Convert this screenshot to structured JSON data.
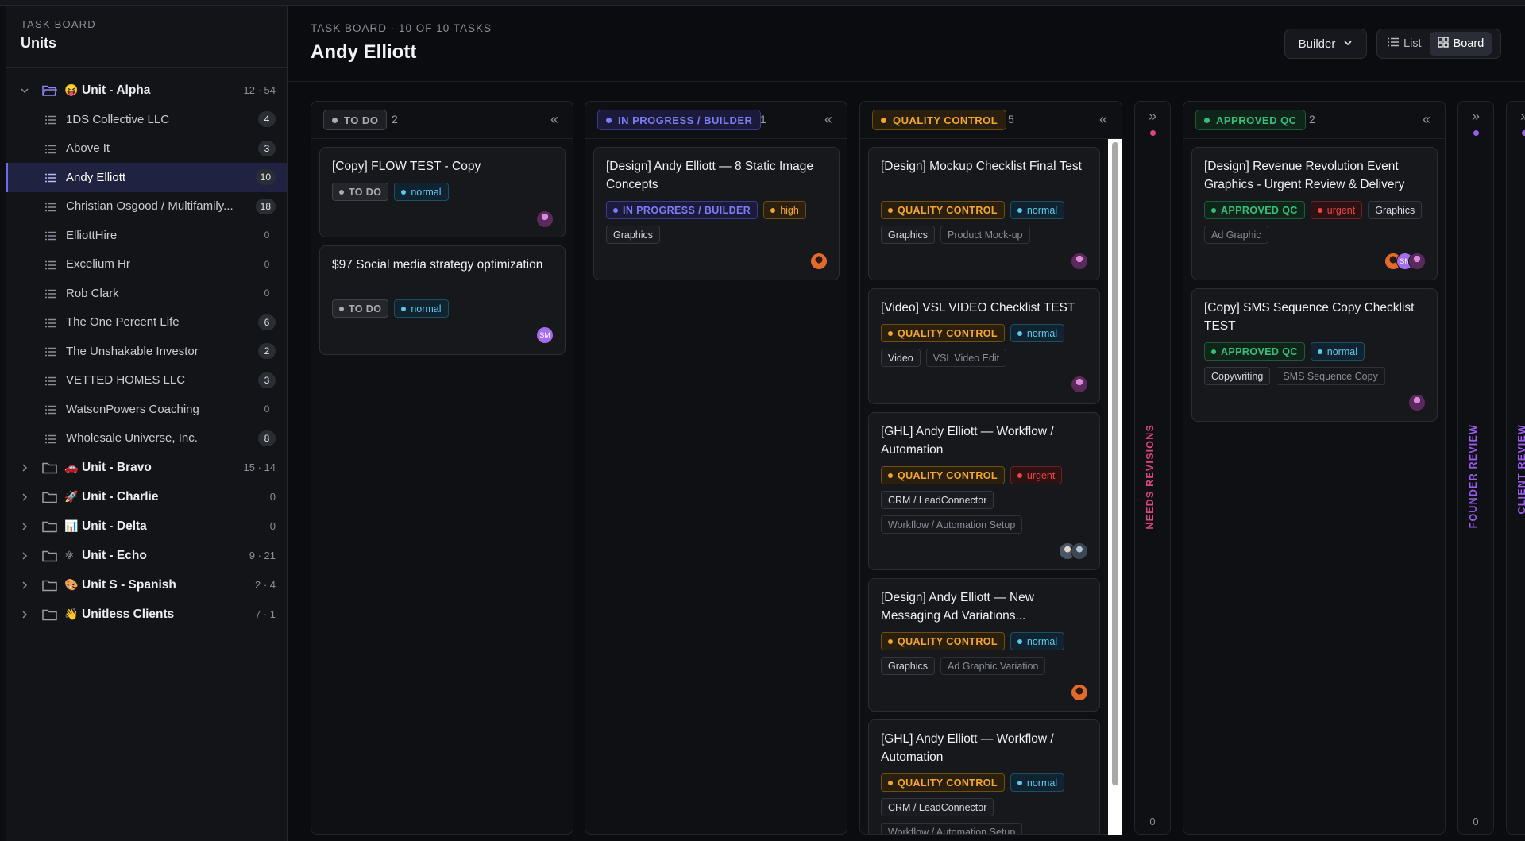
{
  "sidebar": {
    "eyebrow": "TASK BOARD",
    "title": "Units",
    "units": [
      {
        "emoji": "😝",
        "name": "Unit - Alpha",
        "count": "12 · 54",
        "expanded": true
      },
      {
        "emoji": "🚗",
        "name": "Unit - Bravo",
        "count": "15 · 14"
      },
      {
        "emoji": "🚀",
        "name": "Unit - Charlie",
        "count": "0"
      },
      {
        "emoji": "📊",
        "name": "Unit - Delta",
        "count": "0"
      },
      {
        "emoji": "⚛",
        "name": "Unit - Echo",
        "count": "9 · 21"
      },
      {
        "emoji": "🎨",
        "name": "Unit S - Spanish",
        "count": "2 · 4"
      },
      {
        "emoji": "👋",
        "name": "Unitless Clients",
        "count": "7 · 1"
      }
    ],
    "alpha_children": [
      {
        "name": "1DS Collective LLC",
        "count": "4"
      },
      {
        "name": "Above It",
        "count": "3"
      },
      {
        "name": "Andy Elliott",
        "count": "10",
        "active": true
      },
      {
        "name": "Christian Osgood / Multifamily...",
        "count": "18"
      },
      {
        "name": "ElliottHire",
        "count": "0"
      },
      {
        "name": "Excelium Hr",
        "count": "0"
      },
      {
        "name": "Rob Clark",
        "count": "0"
      },
      {
        "name": "The One Percent Life",
        "count": "6"
      },
      {
        "name": "The Unshakable Investor",
        "count": "2"
      },
      {
        "name": "VETTED HOMES LLC",
        "count": "3"
      },
      {
        "name": "WatsonPowers Coaching",
        "count": "0"
      },
      {
        "name": "Wholesale Universe, Inc.",
        "count": "8"
      }
    ]
  },
  "header": {
    "eyebrow": "TASK BOARD · 10 OF 10 TASKS",
    "title": "Andy Elliott",
    "builder_label": "Builder",
    "view_list": "List",
    "view_board": "Board"
  },
  "columns": {
    "todo": {
      "label": "TO DO",
      "count": "2",
      "cards": [
        {
          "title": "[Copy] FLOW TEST - Copy",
          "status": "TO DO",
          "priority": "normal"
        },
        {
          "title": "$97 Social media strategy optimization",
          "status": "TO DO",
          "priority": "normal",
          "avatar": "SM"
        }
      ]
    },
    "progress": {
      "label": "IN PROGRESS / BUILDER",
      "count": "1",
      "cards": [
        {
          "title": "[Design] Andy Elliott — 8 Static Image Concepts",
          "status": "IN PROGRESS / BUILDER",
          "priority": "high",
          "category": "Graphics"
        }
      ]
    },
    "qc": {
      "label": "QUALITY CONTROL",
      "count": "5",
      "cards": [
        {
          "title": "[Design] Mockup Checklist Final Test",
          "status": "QUALITY CONTROL",
          "priority": "normal",
          "category": "Graphics",
          "sub": "Product Mock-up"
        },
        {
          "title": "[Video] VSL VIDEO Checklist TEST",
          "status": "QUALITY CONTROL",
          "priority": "normal",
          "category": "Video",
          "sub": "VSL Video Edit"
        },
        {
          "title": "[GHL] Andy Elliott — Workflow / Automation",
          "status": "QUALITY CONTROL",
          "priority": "urgent",
          "category": "CRM / LeadConnector",
          "sub": "Workflow / Automation Setup"
        },
        {
          "title": "[Design] Andy Elliott — New Messaging Ad Variations...",
          "status": "QUALITY CONTROL",
          "priority": "normal",
          "category": "Graphics",
          "sub": "Ad Graphic Variation"
        },
        {
          "title": "[GHL] Andy Elliott — Workflow / Automation",
          "status": "QUALITY CONTROL",
          "priority": "normal",
          "category": "CRM / LeadConnector",
          "sub": "Workflow / Automation Setup"
        }
      ]
    },
    "needs_revisions": {
      "label": "NEEDS REVISIONS",
      "count": "0",
      "color": "#e0457a"
    },
    "approved": {
      "label": "APPROVED QC",
      "count": "2",
      "cards": [
        {
          "title": "[Design] Revenue Revolution Event Graphics - Urgent Review & Delivery",
          "status": "APPROVED QC",
          "priority": "urgent",
          "category": "Graphics",
          "sub": "Ad Graphic",
          "avatar": "SM"
        },
        {
          "title": "[Copy] SMS Sequence Copy Checklist TEST",
          "status": "APPROVED QC",
          "priority": "normal",
          "category": "Copywriting",
          "sub": "SMS Sequence Copy"
        }
      ]
    },
    "founder_review": {
      "label": "FOUNDER REVIEW",
      "count": "0",
      "color": "#9b5cf0"
    },
    "client_review": {
      "label": "CLIENT REVIEW",
      "color": "#9b5cf0"
    }
  },
  "colors": {
    "accent": "#6b6bf0",
    "todo": "#a8acb4",
    "progress": "#7c7cf3",
    "qc": "#f3a72a",
    "approved": "#34c07c"
  }
}
